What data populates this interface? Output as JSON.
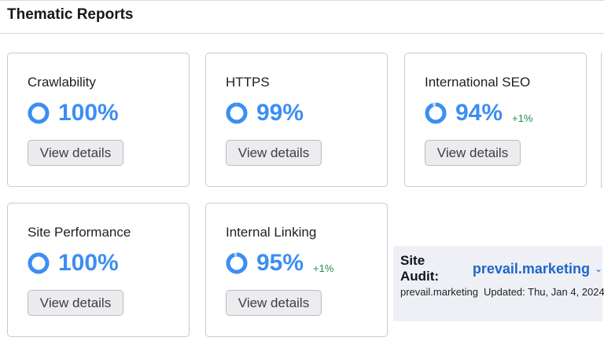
{
  "header": {
    "title": "Thematic Reports"
  },
  "colors": {
    "score_blue": "#3c8ef2",
    "ring_track": "#bcd6f7",
    "delta_green": "#2a8a4e",
    "link_blue": "#1f66c9"
  },
  "cards": [
    {
      "title": "Crawlability",
      "score": "100%",
      "fraction": 1.0,
      "delta": "",
      "button": "View details"
    },
    {
      "title": "HTTPS",
      "score": "99%",
      "fraction": 0.99,
      "delta": "",
      "button": "View details"
    },
    {
      "title": "International SEO",
      "score": "94%",
      "fraction": 0.94,
      "delta": "+1%",
      "button": "View details"
    },
    {
      "title": "Site Performance",
      "score": "100%",
      "fraction": 1.0,
      "delta": "",
      "button": "View details"
    },
    {
      "title": "Internal Linking",
      "score": "95%",
      "fraction": 0.95,
      "delta": "+1%",
      "button": "View details"
    }
  ],
  "site_audit": {
    "label": "Site Audit:",
    "domain": "prevail.marketing",
    "chevron_icon": "chevron-down-icon",
    "project": "prevail.marketing",
    "updated": "Updated: Thu, Jan 4, 2024"
  }
}
